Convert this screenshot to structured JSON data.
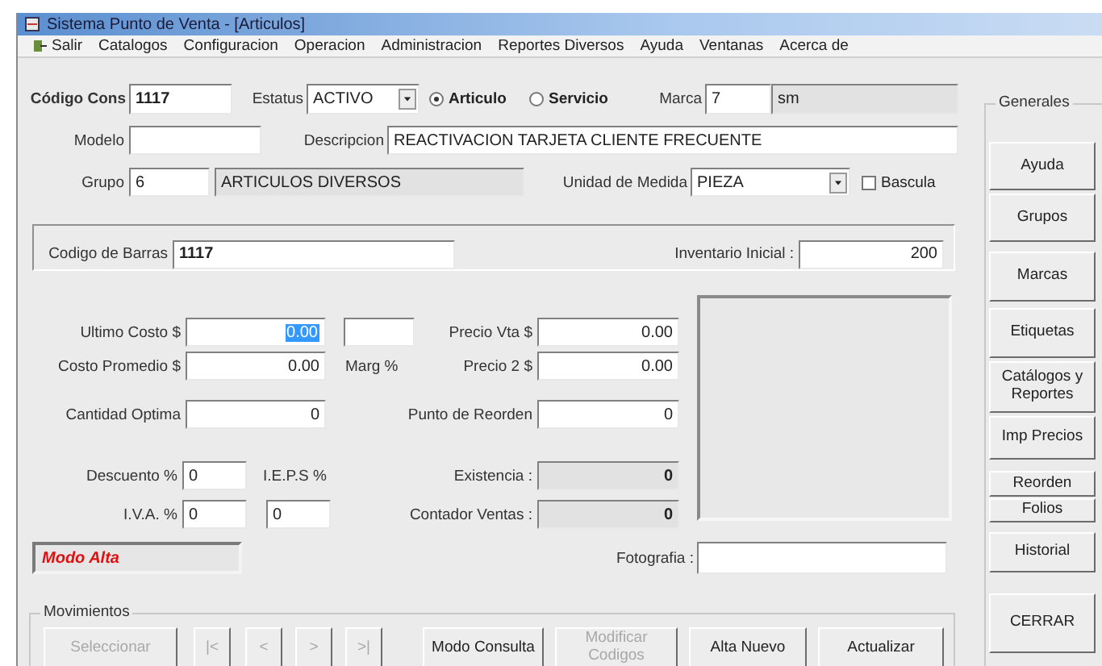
{
  "window": {
    "title": "Sistema Punto de Venta - [Articulos]"
  },
  "menu": [
    "Salir",
    "Catalogos",
    "Configuracion",
    "Operacion",
    "Administracion",
    "Reportes Diversos",
    "Ayuda",
    "Ventanas",
    "Acerca de"
  ],
  "header": {
    "code": {
      "label": "Código Cons",
      "value": "1117"
    },
    "status": {
      "label": "Estatus",
      "value": "ACTIVO"
    },
    "item_type": [
      {
        "label": "Articulo",
        "selected": true
      },
      {
        "label": "Servicio",
        "selected": false
      }
    ],
    "brand": {
      "label": "Marca",
      "value": "7",
      "name": "sm"
    },
    "model": {
      "label": "Modelo"
    },
    "description": {
      "label": "Descripcion",
      "value": "REACTIVACION TARJETA CLIENTE FRECUENTE"
    },
    "group": {
      "label": "Grupo",
      "value": "6",
      "name": "ARTICULOS DIVERSOS"
    },
    "unit": {
      "label": "Unidad de Medida",
      "value": "PIEZA"
    },
    "scale": {
      "label": "Bascula",
      "checked": false
    }
  },
  "barcode_box": {
    "barcode": {
      "label": "Codigo de Barras",
      "value": "1117"
    },
    "initial_stock": {
      "label": "Inventario Inicial :",
      "value": "200"
    }
  },
  "costs": {
    "last_cost": {
      "label": "Ultimo Costo $",
      "value": "0.00",
      "selected": true
    },
    "margin": {
      "label": "Marg %"
    },
    "sale_price": {
      "label": "Precio Vta $",
      "value": "0.00"
    },
    "avg_cost": {
      "label": "Costo Promedio $",
      "value": "0.00"
    },
    "price_2": {
      "label": "Precio 2 $",
      "value": "0.00"
    },
    "optimal_qty": {
      "label": "Cantidad Optima",
      "value": "0"
    },
    "reorder_point": {
      "label": "Punto de Reorden",
      "value": "0"
    },
    "discount": {
      "label": "Descuento %",
      "value": "0"
    },
    "ieps": {
      "label": "I.E.P.S %",
      "value": "0"
    },
    "iva": {
      "label": "I.V.A. %",
      "value": "0"
    },
    "stock": {
      "label": "Existencia :",
      "value": "0"
    },
    "sales_counter": {
      "label": "Contador Ventas :",
      "value": "0"
    }
  },
  "mode": "Modo Alta",
  "photo": {
    "label": "Fotografia :"
  },
  "movements": {
    "title": "Movimientos",
    "buttons": [
      {
        "label": "Seleccionar",
        "disabled": true
      },
      {
        "label": "|<",
        "disabled": true
      },
      {
        "label": "<",
        "disabled": true
      },
      {
        "label": ">",
        "disabled": true
      },
      {
        "label": ">|",
        "disabled": true
      },
      {
        "label": "Modo Consulta",
        "disabled": false
      },
      {
        "label": "Modificar Codigos",
        "disabled": true
      },
      {
        "label": "Alta Nuevo",
        "disabled": false
      },
      {
        "label": "Actualizar",
        "disabled": false
      }
    ]
  },
  "generales": {
    "title": "Generales",
    "buttons": [
      {
        "label": "Ayuda"
      },
      {
        "label": "Grupos"
      },
      {
        "label": "Marcas"
      },
      {
        "label": "Etiquetas"
      },
      {
        "label": "Catálogos y Reportes"
      },
      {
        "label": "Imp Precios"
      },
      {
        "label": "Reorden"
      },
      {
        "label": "Folios"
      },
      {
        "label": "Historial"
      },
      {
        "label": "CERRAR"
      }
    ]
  }
}
